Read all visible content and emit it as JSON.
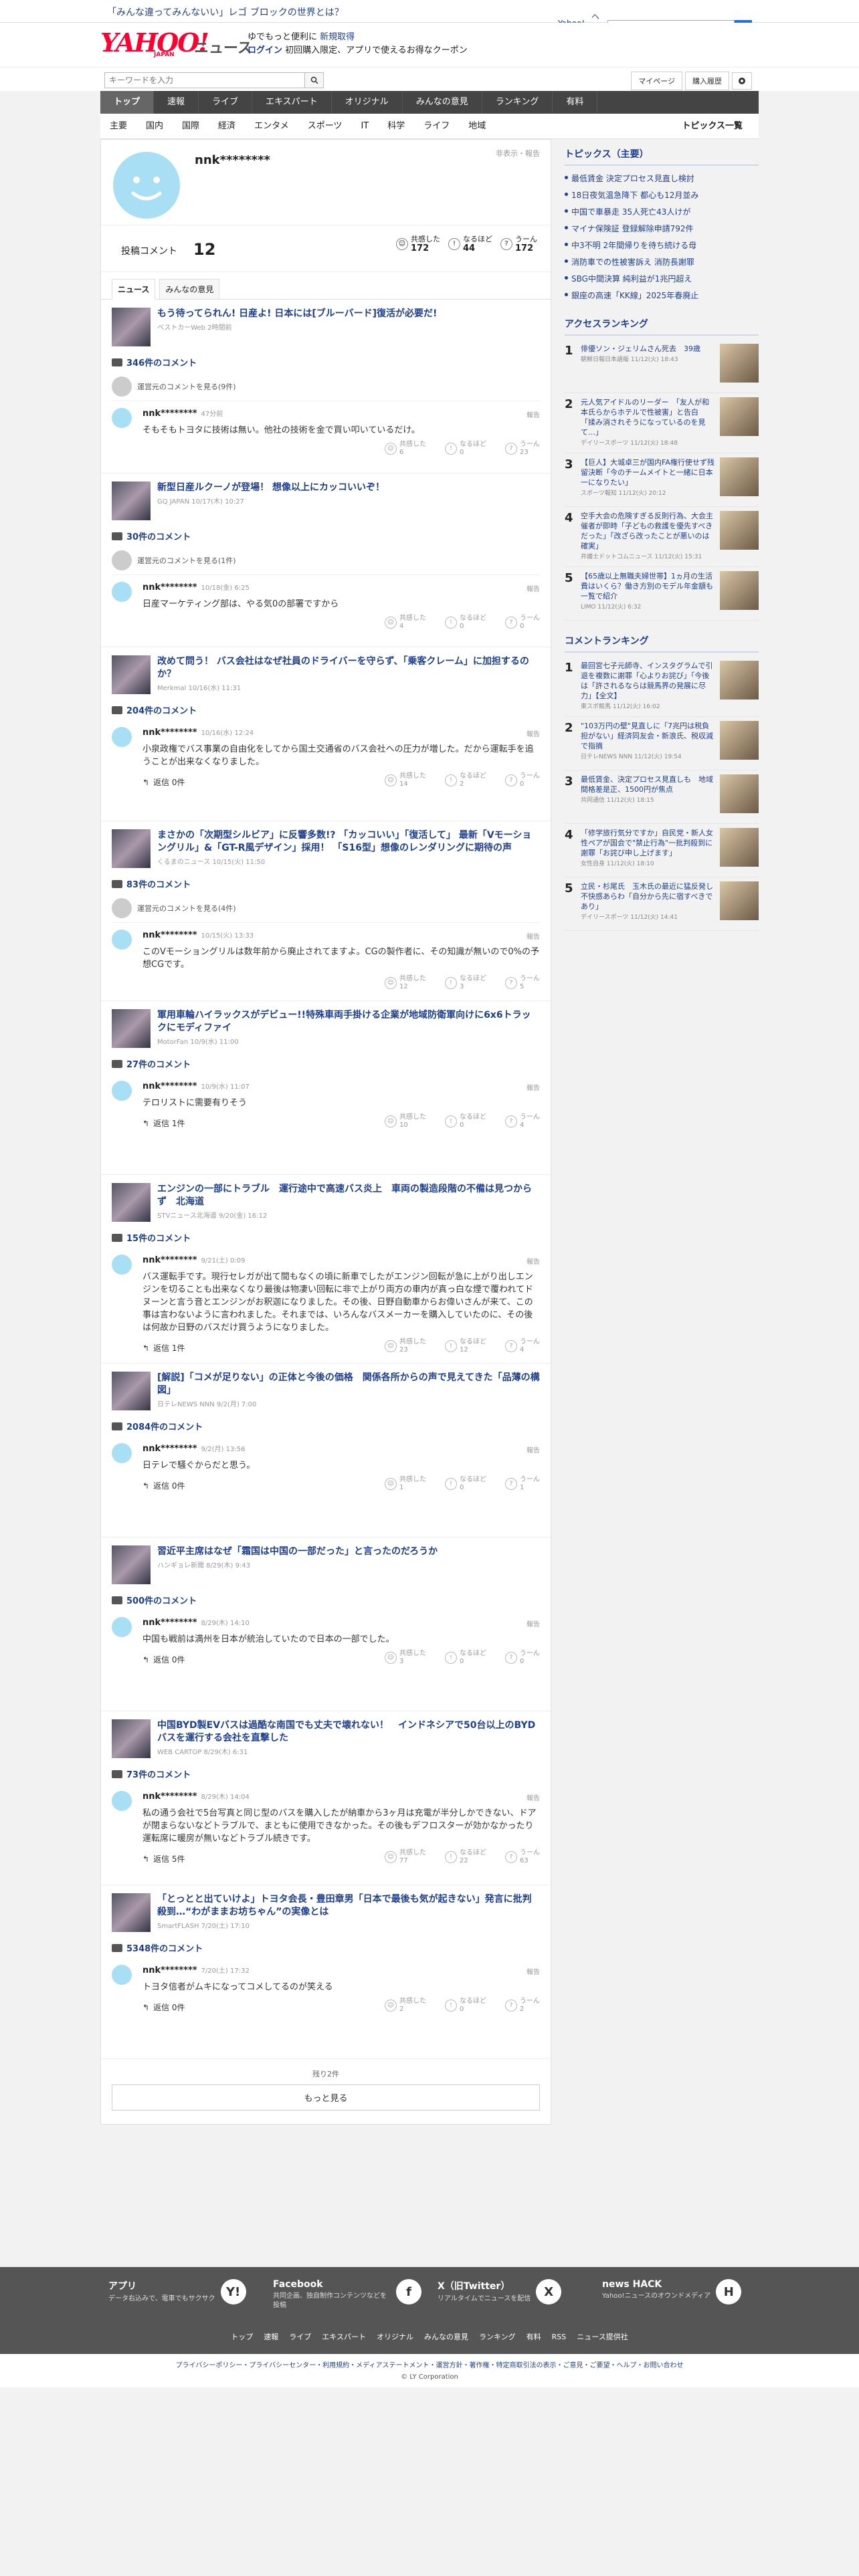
{
  "top": {
    "promo": "「みんな違ってみんないい」レゴ ブロックの世界とは？",
    "yahoo_link": "Yahoo! JAPAN",
    "help": "ヘルプ",
    "search_placeholder": "ウェブ検索"
  },
  "logo": {
    "yahoo": "YAHOO!",
    "japan": "JAPAN",
    "news": "ニュース"
  },
  "login": {
    "line1": "ゆでもっと便利に",
    "new_reg": "新規取得",
    "login": "ログイン",
    "coupon": "初回購入限定、アプリで使えるお得なクーポン"
  },
  "search": {
    "placeholder": "キーワードを入力",
    "mypage": "マイページ",
    "history": "購入履歴"
  },
  "nav": [
    "トップ",
    "速報",
    "ライブ",
    "エキスパート",
    "オリジナル",
    "みんなの意見",
    "ランキング",
    "有料"
  ],
  "subnav": [
    "主要",
    "国内",
    "国際",
    "経済",
    "エンタメ",
    "スポーツ",
    "IT",
    "科学",
    "ライフ",
    "地域"
  ],
  "subnav_all": "トピックス一覧",
  "profile": {
    "name": "nnk********",
    "meta": "非表示・報告",
    "comment_label": "投稿コメント",
    "comment_count": "12",
    "stats": [
      {
        "label": "共感した",
        "value": "172"
      },
      {
        "label": "なるほど",
        "value": "44"
      },
      {
        "label": "うーん",
        "value": "172"
      }
    ]
  },
  "tabs": [
    "ニュース",
    "みんなの意見"
  ],
  "entries": [
    {
      "title": "もう待ってられん! 日産よ! 日本には[ブルーバード]復活が必要だ!",
      "src": "ベストカーWeb 2時間前",
      "count": "346件のコメント",
      "deleted": "運営元のコメントを見る(9件)",
      "time": "47分前",
      "body": "そもそもトヨタに技術は無い。他社の技術を金で買い叩いているだけ。",
      "r": [
        "6",
        "0",
        "23"
      ],
      "replies": ""
    },
    {
      "title": "新型日産ルクーノが登場！ 想像以上にカッコいいぞ！",
      "src": "GQ JAPAN 10/17(木) 10:27",
      "count": "30件のコメント",
      "deleted": "運営元のコメントを見る(1件)",
      "time": "10/18(金) 6:25",
      "body": "日産マーケティング部は、やる気0の部署ですから",
      "r": [
        "4",
        "0",
        "0"
      ],
      "replies": ""
    },
    {
      "title": "改めて問う！ バス会社はなぜ社員のドライバーを守らず、「乗客クレーム」に加担するのか？",
      "src": "Merkmal 10/16(水) 11:31",
      "count": "204件のコメント",
      "deleted": "",
      "time": "10/16(水) 12:24",
      "body": "小泉政権でバス事業の自由化をしてから国土交通省のバス会社への圧力が増した。だから運転手を追うことが出来なくなりました。",
      "r": [
        "14",
        "2",
        "0"
      ],
      "replies": "返信 0件"
    },
    {
      "title": "まさかの「次期型シルビア」に反響多数!? 「カッコいい」「復活して」 最新「Vモーショングリル」&「GT-R風デザイン」採用！ 「S16型」想像のレンダリングに期待の声",
      "src": "くるまのニュース 10/15(火) 11:50",
      "count": "83件のコメント",
      "deleted": "運営元のコメントを見る(4件)",
      "time": "10/15(火) 13:33",
      "body": "このVモーショングリルは数年前から廃止されてますよ。CGの製作者に、その知識が無いので0%の予想CGです。",
      "r": [
        "12",
        "3",
        "5"
      ],
      "replies": ""
    },
    {
      "title": "軍用車輪ハイラックスがデビュー!!特殊車両手掛ける企業が地域防衛軍向けに6x6トラックにモディファイ",
      "src": "MotorFan 10/9(水) 11:00",
      "count": "27件のコメント",
      "deleted": "",
      "time": "10/9(水) 11:07",
      "body": "テロリストに需要有りそう",
      "r": [
        "10",
        "0",
        "4"
      ],
      "replies": "返信 1件"
    },
    {
      "title": "エンジンの一部にトラブル　運行途中で高速バス炎上　車両の製造段階の不備は見つからず　北海道",
      "src": "STVニュース北海道 9/20(金) 16:12",
      "count": "15件のコメント",
      "deleted": "",
      "time": "9/21(土) 0:09",
      "body": "バス運転手です。現行セレガが出て間もなくの頃に新車でしたがエンジン回転が急に上がり出しエンジンを切ることも出来なくなり最後は物凄い回転に非で上がり両方の車内が真っ白な煙で覆われてドヌーンと言う音とエンジンがお釈迦になりました。その後、日野自動車からお偉いさんが来て、この事は言わないように言われました。それまでは、いろんなバスメーカーを購入していたのに、その後は何故か日野のバスだけ買うようになりました。",
      "r": [
        "23",
        "12",
        "4"
      ],
      "replies": "返信 1件"
    },
    {
      "title": "[解説]「コメが足りない」の正体と今後の価格　関係各所からの声で見えてきた「品薄の構図」",
      "src": "日テレNEWS NNN 9/2(月) 7:00",
      "count": "2084件のコメント",
      "deleted": "",
      "time": "9/2(月) 13:56",
      "body": "日テレで騒ぐからだと思う。",
      "r": [
        "1",
        "0",
        "1"
      ],
      "replies": "返信 0件"
    },
    {
      "title": "習近平主席はなぜ「霜国は中国の一部だった」と言ったのだろうか",
      "src": "ハンギョレ新聞 8/29(木) 9:43",
      "count": "500件のコメント",
      "deleted": "",
      "time": "8/29(木) 14:10",
      "body": "中国も戦前は満州を日本が統治していたので日本の一部でした。",
      "r": [
        "3",
        "0",
        "0"
      ],
      "replies": "返信 0件"
    },
    {
      "title": "中国BYD製EVバスは過酷な南国でも丈夫で壊れない！　インドネシアで50台以上のBYDバスを運行する会社を直撃した",
      "src": "WEB CARTOP 8/29(木) 6:31",
      "count": "73件のコメント",
      "deleted": "",
      "time": "8/29(木) 14:04",
      "body": "私の通う会社で5台写真と同じ型のバスを購入したが納車から3ヶ月は充電が半分しかできない、ドアが閉まらないなどトラブルで、まともに使用できなかった。その後もデフロスターが効かなかったり運転席に暖房が無いなどトラブル続きです。",
      "r": [
        "77",
        "22",
        "63"
      ],
      "replies": "返信 5件"
    },
    {
      "title": "「とっとと出ていけよ」トヨタ会長・豊田章男「日本で最後も気が起きない」発言に批判殺到…“わがままお坊ちゃん”の実像とは",
      "src": "SmartFLASH 7/20(土) 17:10",
      "count": "5348件のコメント",
      "deleted": "",
      "time": "7/20(土) 17:32",
      "body": "トヨタ信者がムキになってコメしてるのが笑える",
      "r": [
        "2",
        "0",
        "2"
      ],
      "replies": "返信 0件"
    }
  ],
  "react_labels": [
    "共感した",
    "なるほど",
    "うーん"
  ],
  "report": "報告",
  "more": {
    "remaining": "残り2件",
    "button": "もっと見る"
  },
  "topics": {
    "title": "トピックス（主要）",
    "items": [
      "最低賃金 決定プロセス見直し検討",
      "18日夜気温急降下 都心も12月並み",
      "中国で車暴走 35人死亡43人けが",
      "マイナ保険証 登録解除申請792件",
      "中3不明 2年間帰りを待ち続ける母",
      "消防車での性被害訴え 消防長謝罪",
      "SBG中間決算 純利益が1兆円超え",
      "銀座の高速「KK線」2025年春廃止"
    ]
  },
  "access": {
    "title": "アクセスランキング",
    "items": [
      {
        "t": "俳優ソン・ジェリムさん死去　39歳",
        "s": "朝鮮日報日本語版 11/12(火) 18:43"
      },
      {
        "t": "元人気アイドルのリーダー　「友人が和本氏らからホテルで性被害」と告白　「揉み消されそうになっているのを見て…」",
        "s": "デイリースポーツ 11/12(火) 18:48"
      },
      {
        "t": "【巨人】大城卓三が国内FA権行使せず残留決断「今のチームメイトと一緒に日本一になりたい」",
        "s": "スポーツ報知 11/12(火) 20:12"
      },
      {
        "t": "空手大会の危険すぎる反則行為、大会主催者が即時「子どもの救護を優先すべきだった」「改ざら改ったことが悪いのは確実」",
        "s": "弁護士ドットコムニュース 11/12(火) 15:31"
      },
      {
        "t": "【65歳以上無職夫婦世帯】1ヵ月の生活費はいくら？働き方別のモデル年金額も一覧で紹介",
        "s": "LIMO 11/12(火) 6:32"
      }
    ]
  },
  "commentrank": {
    "title": "コメントランキング",
    "items": [
      {
        "t": "最回宮七子元師寺、インスタグラムで引退を複数に謝罪「心よりお詫び」「今後は「許されるならは競馬界の発展に尽力」【全文】",
        "s": "東スポ競馬 11/12(火) 16:02"
      },
      {
        "t": "\"103万円の壁\"見直しに「7兆円は税負担がない」経済同友会・新浪氏、税収減で指摘",
        "s": "日テレNEWS NNN 11/12(火) 19:54"
      },
      {
        "t": "最低賃金、決定プロセス見直しも　地域間格差是正、1500円が焦点",
        "s": "共同通信 11/12(火) 18:15"
      },
      {
        "t": "「修学旅行気分ですか」自民党・新人女性ペアが国会で\"禁止行為\"一批判殺到に謝罪「お詫び申し上げます」",
        "s": "女性自身 11/12(火) 18:10"
      },
      {
        "t": "立民・杉尾氏　玉木氏の最近に猛反発し不快感あらわ「自分から先に宿すべきであり」",
        "s": "デイリースポーツ 11/12(火) 14:41"
      }
    ]
  },
  "footer": {
    "cols": [
      {
        "t": "アプリ",
        "d": "データ右込みで、電車でもサクサク",
        "icon": "Y!"
      },
      {
        "t": "Facebook",
        "d": "共同企画、独自制作コンテンツなどを投稿",
        "icon": "f"
      },
      {
        "t": "X（旧Twitter）",
        "d": "リアルタイムでニュースを配信",
        "icon": "X"
      },
      {
        "t": "news HACK",
        "d": "Yahoo!ニュースのオウンドメディア",
        "icon": "H"
      }
    ],
    "links": [
      "トップ",
      "速報",
      "ライブ",
      "エキスパート",
      "オリジナル",
      "みんなの意見",
      "ランキング",
      "有料",
      "RSS",
      "ニュース提供社"
    ],
    "legal": "プライバシーポリシー・プライバシーセンター・利用規約・メディアステートメント・運営方針・著作権・特定商取引法の表示・ご意見・ご要望・ヘルプ・お問い合わせ",
    "copy": "© LY Corporation"
  }
}
